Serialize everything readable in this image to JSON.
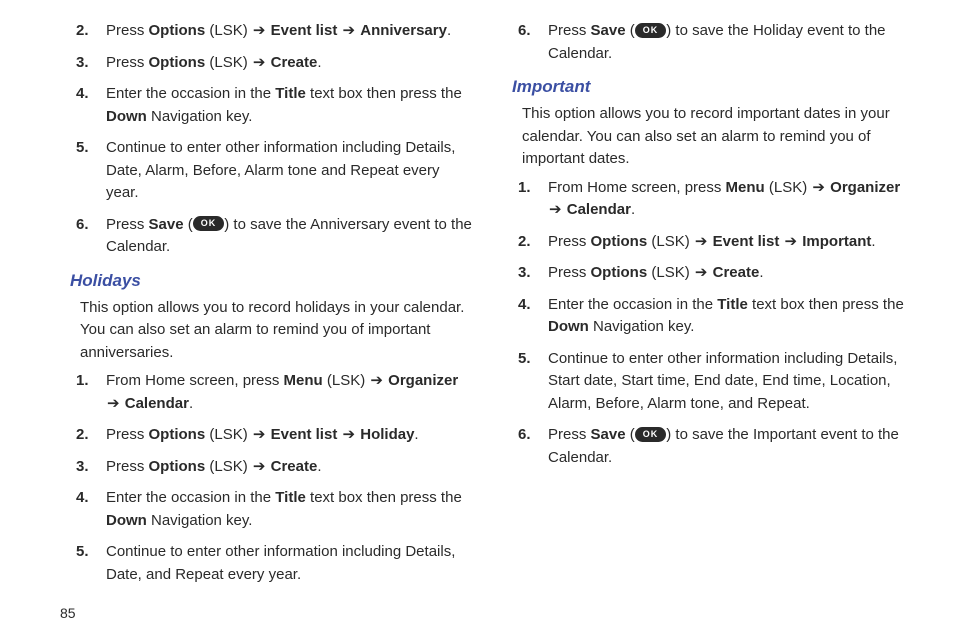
{
  "arrow": "➔",
  "page_number": "85",
  "ok_label": "OK",
  "col1": {
    "anniversary_steps": [
      {
        "num": "2.",
        "parts": [
          "Press ",
          {
            "b": "Options"
          },
          " (LSK) ",
          {
            "arrow": true
          },
          " ",
          {
            "b": "Event list"
          },
          " ",
          {
            "arrow": true
          },
          " ",
          {
            "b": "Anniversary"
          },
          "."
        ]
      },
      {
        "num": "3.",
        "parts": [
          "Press ",
          {
            "b": "Options"
          },
          " (LSK) ",
          {
            "arrow": true
          },
          " ",
          {
            "b": "Create"
          },
          "."
        ]
      },
      {
        "num": "4.",
        "parts": [
          "Enter the occasion in the ",
          {
            "b": "Title"
          },
          " text box then press the ",
          {
            "b": "Down"
          },
          " Navigation key."
        ]
      },
      {
        "num": "5.",
        "parts": [
          "Continue to enter other information including Details, Date, Alarm, Before, Alarm tone and Repeat every year."
        ]
      },
      {
        "num": "6.",
        "parts": [
          "Press ",
          {
            "b": "Save"
          },
          " (",
          {
            "ok": true
          },
          ") to save the Anniversary event to the Calendar."
        ]
      }
    ],
    "holidays_heading": "Holidays",
    "holidays_intro": "This option allows you to record holidays in your calendar. You can also set an alarm to remind you of important anniversaries.",
    "holidays_steps": [
      {
        "num": "1.",
        "parts": [
          "From Home screen, press ",
          {
            "b": "Menu"
          },
          " (LSK) ",
          {
            "arrow": true
          },
          " ",
          {
            "b": "Organizer"
          },
          " ",
          {
            "arrow": true
          },
          " ",
          {
            "b": "Calendar"
          },
          "."
        ]
      },
      {
        "num": "2.",
        "parts": [
          "Press ",
          {
            "b": "Options"
          },
          " (LSK) ",
          {
            "arrow": true
          },
          " ",
          {
            "b": "Event list"
          },
          " ",
          {
            "arrow": true
          },
          " ",
          {
            "b": "Holiday"
          },
          "."
        ]
      },
      {
        "num": "3.",
        "parts": [
          "Press ",
          {
            "b": "Options"
          },
          " (LSK) ",
          {
            "arrow": true
          },
          " ",
          {
            "b": "Create"
          },
          "."
        ]
      },
      {
        "num": "4.",
        "parts": [
          "Enter the occasion in the ",
          {
            "b": "Title"
          },
          " text box then press the ",
          {
            "b": "Down"
          },
          " Navigation key."
        ]
      },
      {
        "num": "5.",
        "parts": [
          "Continue to enter other information including Details, Date, and Repeat every year."
        ]
      }
    ]
  },
  "col2": {
    "holiday_save_step": {
      "num": "6.",
      "parts": [
        "Press ",
        {
          "b": "Save"
        },
        " (",
        {
          "ok": true
        },
        ") to save the Holiday event to the Calendar."
      ]
    },
    "important_heading": "Important",
    "important_intro": "This option allows you to record important dates in your calendar. You can also set an alarm to remind you of important dates.",
    "important_steps": [
      {
        "num": "1.",
        "parts": [
          "From Home screen, press ",
          {
            "b": "Menu"
          },
          " (LSK) ",
          {
            "arrow": true
          },
          " ",
          {
            "b": "Organizer"
          },
          " ",
          {
            "arrow": true
          },
          " ",
          {
            "b": "Calendar"
          },
          "."
        ]
      },
      {
        "num": "2.",
        "parts": [
          "Press ",
          {
            "b": "Options"
          },
          " (LSK) ",
          {
            "arrow": true
          },
          " ",
          {
            "b": "Event list"
          },
          " ",
          {
            "arrow": true
          },
          " ",
          {
            "b": "Important"
          },
          "."
        ]
      },
      {
        "num": "3.",
        "parts": [
          "Press ",
          {
            "b": "Options"
          },
          " (LSK) ",
          {
            "arrow": true
          },
          " ",
          {
            "b": "Create"
          },
          "."
        ]
      },
      {
        "num": "4.",
        "parts": [
          "Enter the occasion in the ",
          {
            "b": "Title"
          },
          " text box then press the ",
          {
            "b": "Down"
          },
          " Navigation key."
        ]
      },
      {
        "num": "5.",
        "parts": [
          "Continue to enter other information including Details, Start date, Start time, End date, End time, Location, Alarm, Before, Alarm tone, and Repeat."
        ]
      },
      {
        "num": "6.",
        "parts": [
          "Press ",
          {
            "b": "Save"
          },
          " (",
          {
            "ok": true
          },
          ") to save the Important event to the Calendar."
        ]
      }
    ]
  }
}
